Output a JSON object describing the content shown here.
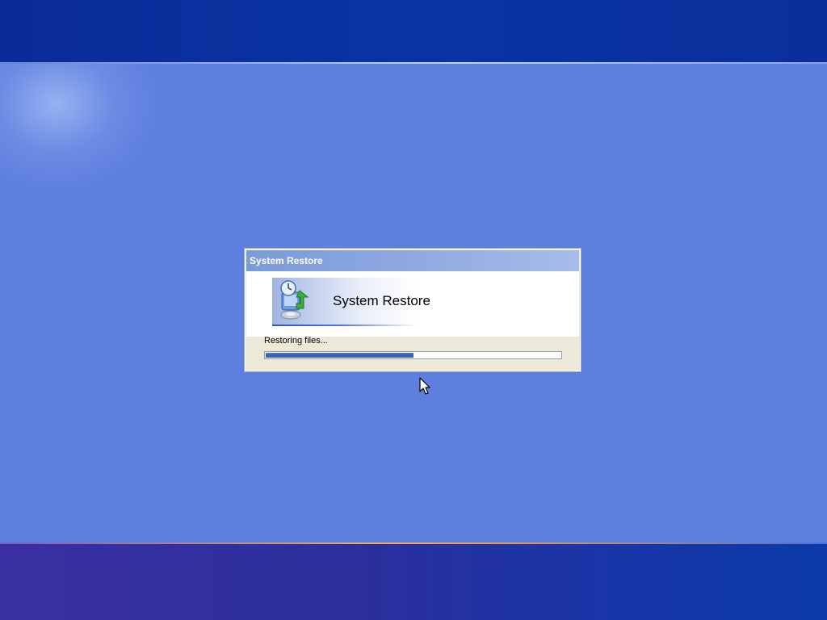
{
  "window": {
    "title": "System Restore"
  },
  "banner": {
    "title": "System Restore",
    "icon": "system-restore-icon"
  },
  "status": {
    "text": "Restoring files..."
  },
  "progress": {
    "fraction": 0.5
  },
  "colors": {
    "desktop": "#5f7fdf",
    "top_band": "#0a2f9c",
    "title_bar": "#8fa9e1",
    "progress_fill": "#2f5cc2",
    "dialog_body": "#ece9d8"
  }
}
